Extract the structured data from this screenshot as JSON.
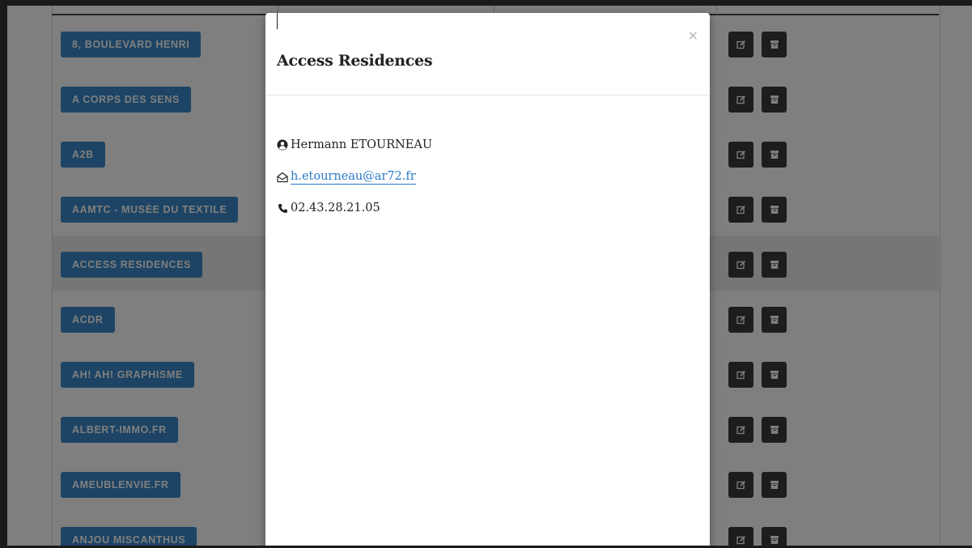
{
  "clients": [
    {
      "name": "8, BOULEVARD HENRI"
    },
    {
      "name": "A CORPS DES SENS"
    },
    {
      "name": "A2B"
    },
    {
      "name": "AAMTC - MUSÉE DU TEXTILE"
    },
    {
      "name": "ACCESS RESIDENCES"
    },
    {
      "name": "ACDR"
    },
    {
      "name": "AH! AH! GRAPHISME"
    },
    {
      "name": "ALBERT-IMMO.FR"
    },
    {
      "name": "AMEUBLENVIE.FR"
    },
    {
      "name": "ANJOU MISCANTHUS"
    }
  ],
  "modal": {
    "title": "Access Residences",
    "close_symbol": "×",
    "contact_name": "Hermann ETOURNEAU",
    "email": "h.etourneau@ar72.fr",
    "phone": "02.43.28.21.05"
  },
  "icons": {
    "user": "user-circle-icon",
    "email": "envelope-open-icon",
    "phone": "phone-icon",
    "edit": "edit-icon",
    "archive": "archive-icon"
  },
  "colors": {
    "client_button": "#3a88c8",
    "action_button": "#3a3a3a",
    "link": "#2a7ac7",
    "overlay": "rgba(0,0,0,0.5)"
  }
}
